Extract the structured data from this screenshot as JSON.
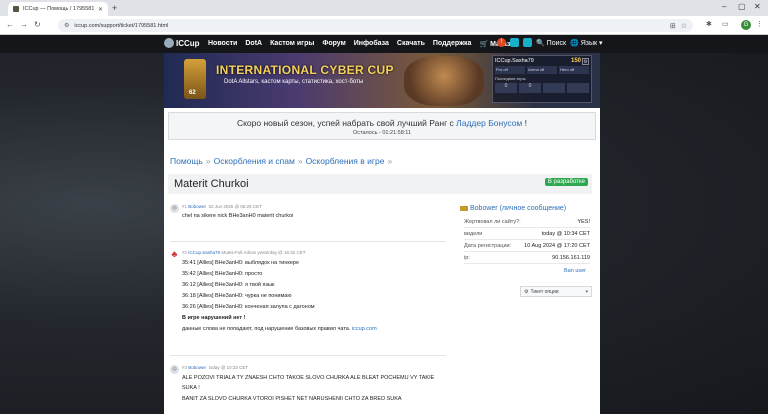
{
  "browser": {
    "tab_title": "ICCup — Помощь / 1795581",
    "url": "iccup.com/support/ticket/1795581.html",
    "profile_initial": "G"
  },
  "site": {
    "logo_text": "ICCup",
    "nav": [
      "Новости",
      "DotA",
      "Кастом игры",
      "Форум",
      "Инфобаза",
      "Скачать",
      "Поддержка"
    ],
    "shop_label": "Магазин",
    "notif_count": "!",
    "search_label": "Поиск",
    "lang_label": "Язык"
  },
  "banner": {
    "title": "INTERNATIONAL CYBER CUP",
    "subtitle": "DotA Allstars, кастом карты, статистика, хост-боты",
    "level": "62"
  },
  "user_panel": {
    "username": "ICCup.Sasha79",
    "points": "150",
    "cells": [
      "Pro.off",
      "Arena off",
      "Hero off"
    ],
    "line": "Последние игры",
    "values": [
      "0",
      "0"
    ]
  },
  "season": {
    "text_before": "Скоро новый сезон, успей набрать свой лучший Ранг с ",
    "link": "Ладдер Бонусом",
    "text_after": " !",
    "timer": "Осталось - 01:21:58:11"
  },
  "breadcrumbs": [
    "Помощь",
    "Оскорбления и спам",
    "Оскорбления в игре"
  ],
  "breadcrumb_sep": "»",
  "ticket": {
    "title": "Materit Churkoi",
    "status": "В разработке"
  },
  "posts": [
    {
      "num": "#1",
      "author": "Bobower",
      "date": "02 Jun 2025 @ 05:25 CET",
      "lines": [
        "chel na sikere nick BHe3anH0 materit churkoi"
      ]
    },
    {
      "num": "#2",
      "author": "ICCup.Sasha79",
      "role": "Mutes-Full Admin",
      "date": "yesterday @ 16:32 CET",
      "lines": [
        "35:41 [Allies] BHe3anH0: выблядок на тинкере",
        "35:42 [Allies] BHe3anH0: просто",
        "36:12 [Allies] BHe3anH0: я твой язык",
        "36:18 [Allies] BHe3anH0: чурка не понимаю",
        "36:26 [Allies] BHe3anH0: конченая залупа с дагоном"
      ],
      "bold_line": "В игре нарушений нет !",
      "last_line": "данные слова не попадают, под нарушение базовых правил чата.",
      "last_link": "iccup.com"
    },
    {
      "num": "#3",
      "author": "Bobower",
      "date": "today @ 10:33 CET",
      "lines": [
        "ALE POZOVI TRIALA TY ZNAESH CHTO TAKOE SLOVO CHURKA ALE BLEAT POCHEMU VY TAKIE SUKA !",
        "BANIT ZA SLOVO CHURKA VTOROI PISHET NET NARUSHENII CHTO ZA BRED SUKA"
      ]
    }
  ],
  "sidebar": {
    "title": "Bobower (личное сообщение)",
    "rows": [
      {
        "k": "Жертвовал ли сайту?:",
        "v": "YES!"
      },
      {
        "k": "видели",
        "v": "today @ 10:34 CET"
      },
      {
        "k": "Дата регистрации:",
        "v": "10 Aug 2024 @ 17:20 CET"
      },
      {
        "k": "ip:",
        "v": "90.156.161.119"
      }
    ],
    "ban": "Ban user",
    "ticket_options": "Тикет опции"
  }
}
